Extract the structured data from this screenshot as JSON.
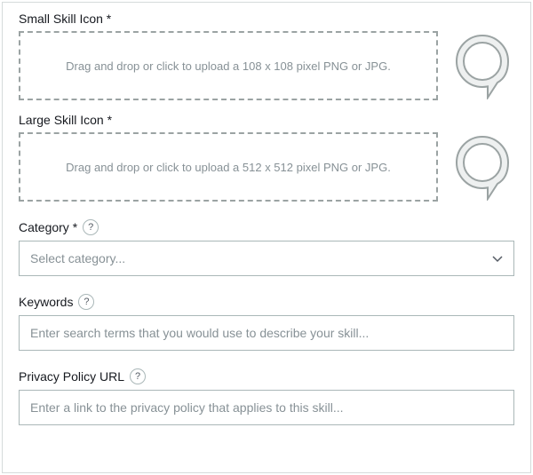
{
  "smallIcon": {
    "label": "Small Skill Icon *",
    "dropText": "Drag and drop or click to upload a 108 x 108 pixel PNG or JPG."
  },
  "largeIcon": {
    "label": "Large Skill Icon *",
    "dropText": "Drag and drop or click to upload a 512 x 512 pixel PNG or JPG."
  },
  "category": {
    "label": "Category *",
    "placeholder": "Select category..."
  },
  "keywords": {
    "label": "Keywords",
    "placeholder": "Enter search terms that you would use to describe your skill..."
  },
  "privacy": {
    "label": "Privacy Policy URL",
    "placeholder": "Enter a link to the privacy policy that applies to this skill..."
  },
  "help": "?"
}
